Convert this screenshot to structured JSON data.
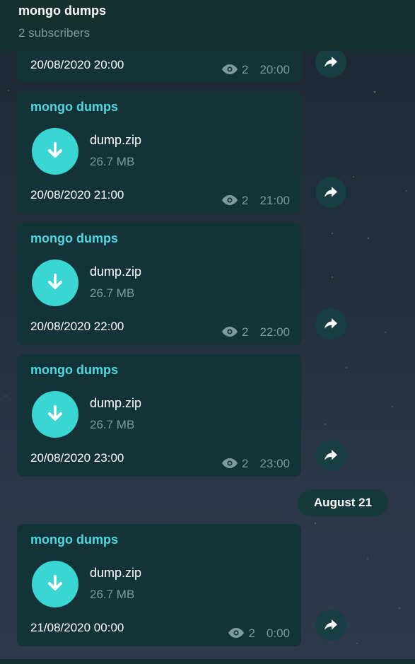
{
  "header": {
    "title": "mongo dumps",
    "subtitle": "2 subscribers"
  },
  "messages": [
    {
      "caption": "20/08/2020 20:00",
      "views": "2",
      "time": "20:00"
    },
    {
      "sender": "mongo dumps",
      "file_name": "dump.zip",
      "file_size": "26.7 MB",
      "caption": "20/08/2020 21:00",
      "views": "2",
      "time": "21:00"
    },
    {
      "sender": "mongo dumps",
      "file_name": "dump.zip",
      "file_size": "26.7 MB",
      "caption": "20/08/2020 22:00",
      "views": "2",
      "time": "22:00"
    },
    {
      "sender": "mongo dumps",
      "file_name": "dump.zip",
      "file_size": "26.7 MB",
      "caption": "20/08/2020 23:00",
      "views": "2",
      "time": "23:00"
    },
    {
      "sender": "mongo dumps",
      "file_name": "dump.zip",
      "file_size": "26.7 MB",
      "caption": "21/08/2020 00:00",
      "views": "2",
      "time": "0:00"
    }
  ],
  "date_separator": "August 21",
  "icons": {
    "download": "download-arrow-icon",
    "views": "eye-icon",
    "share": "share-arrow-icon"
  },
  "colors": {
    "header_bg": "#15302f",
    "bubble_bg": "#143338",
    "accent": "#4fd8df",
    "download_button": "#3ad6d4",
    "muted_text": "#7f9a9b"
  }
}
